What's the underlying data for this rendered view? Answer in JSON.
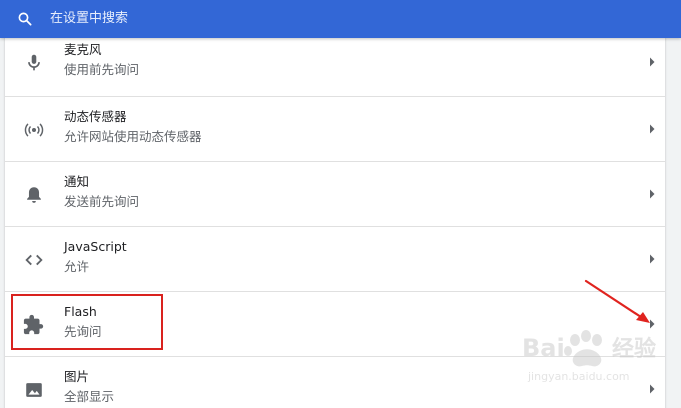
{
  "search": {
    "placeholder": "在设置中搜索"
  },
  "settings_rows": [
    {
      "title": "麦克风",
      "subtitle": "使用前先询问",
      "icon": "microphone-icon"
    },
    {
      "title": "动态传感器",
      "subtitle": "允许网站使用动态传感器",
      "icon": "motion-sensor-icon"
    },
    {
      "title": "通知",
      "subtitle": "发送前先询问",
      "icon": "bell-icon"
    },
    {
      "title": "JavaScript",
      "subtitle": "允许",
      "icon": "code-icon"
    },
    {
      "title": "Flash",
      "subtitle": "先询问",
      "icon": "puzzle-icon"
    },
    {
      "title": "图片",
      "subtitle": "全部显示",
      "icon": "image-icon"
    }
  ],
  "annotation": {
    "highlighted_row": "Flash",
    "color": "#d9221e"
  },
  "watermark": {
    "brand": "Baidu 经验",
    "url": "jingyan.baidu.com"
  },
  "colors": {
    "header": "#3367d6",
    "background": "#f1f3f4",
    "card": "#ffffff",
    "icon": "#5f6368"
  }
}
